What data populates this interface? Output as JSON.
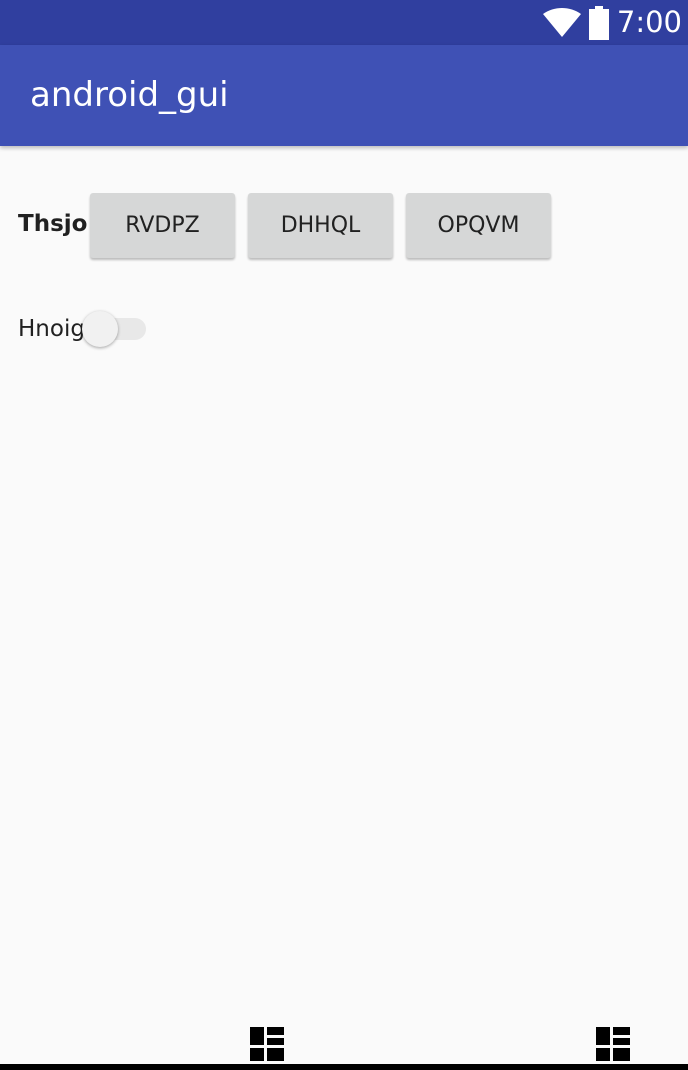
{
  "status_bar": {
    "time": "7:00",
    "icons": [
      "wifi-icon",
      "battery-icon"
    ]
  },
  "app_bar": {
    "title": "android_gui"
  },
  "row1": {
    "label": "Thsjo",
    "buttons": [
      "RVDPZ",
      "DHHQL",
      "OPQVM"
    ]
  },
  "row2": {
    "label": "Hnoig",
    "switch_on": false
  },
  "colors": {
    "status_bar": "#303f9f",
    "app_bar": "#3f51b5",
    "background": "#fafafa",
    "button": "#d6d7d7"
  }
}
